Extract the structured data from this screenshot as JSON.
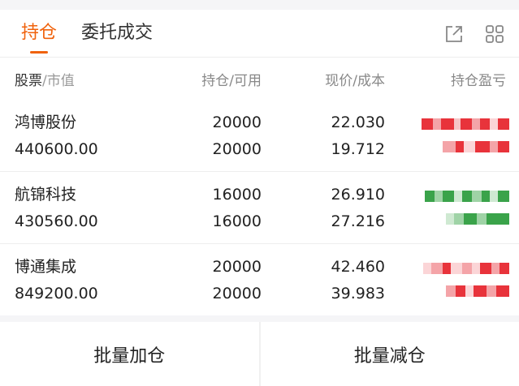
{
  "tabs": [
    {
      "label": "持仓",
      "active": true
    },
    {
      "label": "委托成交",
      "active": false
    }
  ],
  "header": {
    "col1_main": "股票",
    "col1_sub": "/市值",
    "col2": "持仓/可用",
    "col3": "现价/成本",
    "col4": "持仓盈亏"
  },
  "rows": [
    {
      "name": "鸿博股份",
      "market_value": "440600.00",
      "position": "20000",
      "available": "20000",
      "price": "22.030",
      "cost": "19.712",
      "pnl_color": "#e8333b"
    },
    {
      "name": "航锦科技",
      "market_value": "430560.00",
      "position": "16000",
      "available": "16000",
      "price": "26.910",
      "cost": "27.216",
      "pnl_color": "#3aa34a"
    },
    {
      "name": "博通集成",
      "market_value": "849200.00",
      "position": "20000",
      "available": "20000",
      "price": "42.460",
      "cost": "39.983",
      "pnl_color": "#e8333b"
    }
  ],
  "footer": {
    "left_button": "批量加仓",
    "right_button": "批量减仓"
  },
  "colors": {
    "accent": "#f0620c",
    "up": "#e8333b",
    "down": "#3aa34a"
  },
  "icons": [
    "share-icon",
    "grid-icon"
  ]
}
